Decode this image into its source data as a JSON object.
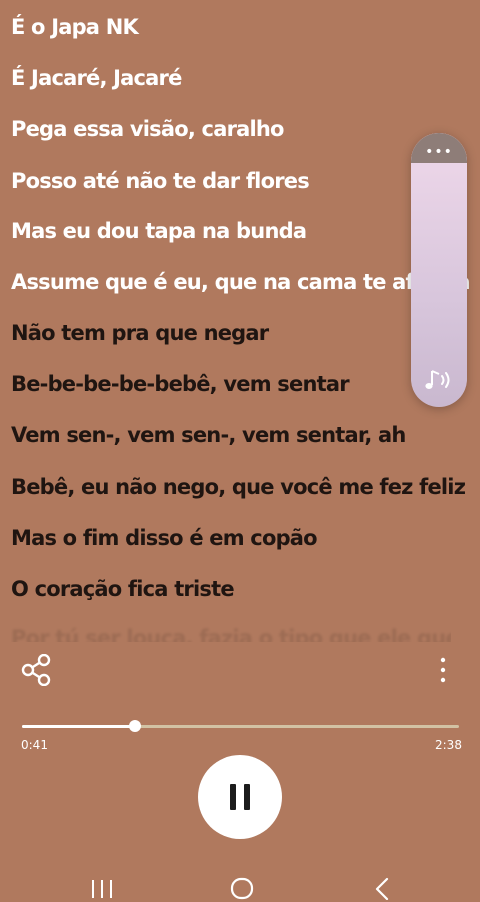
{
  "lyrics": {
    "lines": [
      {
        "text": "É o Japa NK",
        "state": "past"
      },
      {
        "text": "É Jacaré, Jacaré",
        "state": "past"
      },
      {
        "text": "Pega essa visão, caralho",
        "state": "past"
      },
      {
        "text": "Posso até não te dar flores",
        "state": "past"
      },
      {
        "text": "Mas eu dou tapa na bunda",
        "state": "past"
      },
      {
        "text": "Assume que é eu, que na cama te afunda",
        "state": "past"
      },
      {
        "text": "Não tem pra que negar",
        "state": "next"
      },
      {
        "text": "Be-be-be-be-bebê, vem sentar",
        "state": "next"
      },
      {
        "text": "Vem sen-, vem sen-, vem sentar, ah",
        "state": "next"
      },
      {
        "text": "Bebê, eu não nego, que você me fez feliz",
        "state": "next"
      },
      {
        "text": "Mas o fim disso é em copão",
        "state": "next"
      },
      {
        "text": "O coração fica triste",
        "state": "next"
      }
    ],
    "faded_line": "Por tú ser louca, fazia o tipo que ele quer de pai"
  },
  "volume_panel": {
    "more_icon": "more-horizontal-icon",
    "level": 1.0,
    "icon": "music-note-volume-icon"
  },
  "controls": {
    "share_icon": "share-icon",
    "more_icon": "more-vertical-icon"
  },
  "playback": {
    "elapsed": "0:41",
    "total": "2:38",
    "progress": 0.259,
    "state": "playing",
    "pause_icon": "pause-icon"
  },
  "navbar": {
    "recent_icon": "recent-apps-icon",
    "home_icon": "home-icon",
    "back_icon": "back-icon"
  },
  "colors": {
    "background": "#b0795e",
    "past_lyric": "#ffffff",
    "upcoming_lyric": "#1f1511",
    "volume_panel": "#d8c6dc"
  }
}
